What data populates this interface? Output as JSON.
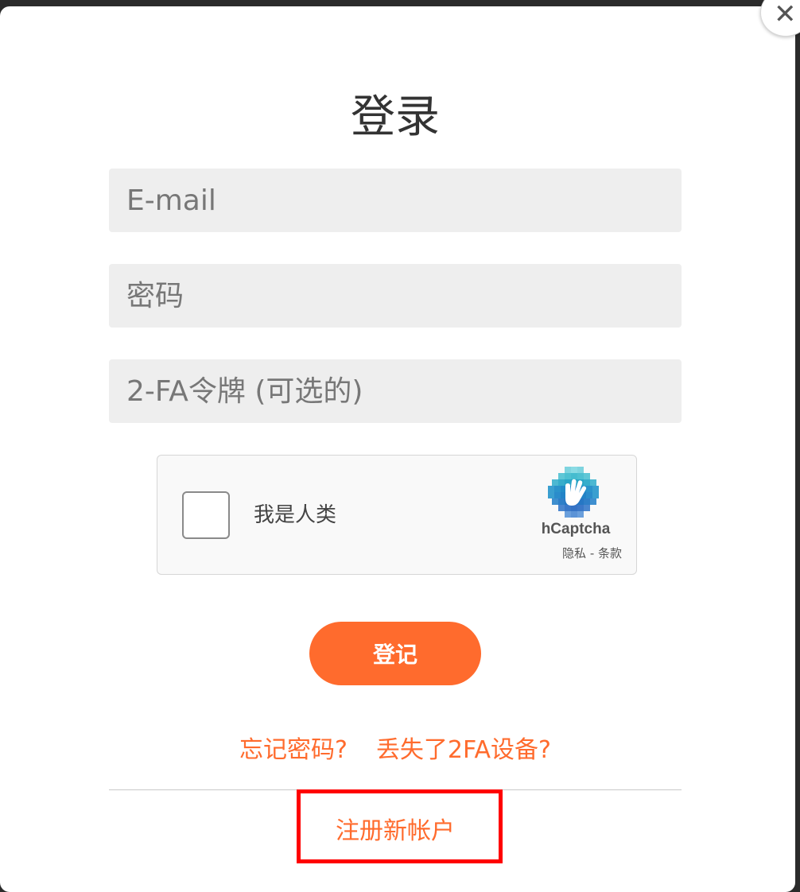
{
  "modal": {
    "title": "登录",
    "close_icon": "close-icon"
  },
  "form": {
    "email_placeholder": "E-mail",
    "password_placeholder": "密码",
    "twofa_placeholder": "2-FA令牌 (可选的)",
    "submit_label": "登记"
  },
  "captcha": {
    "label": "我是人类",
    "brand": "hCaptcha",
    "links": "隐私 - 条款"
  },
  "links": {
    "forgot_password": "忘记密码?",
    "lost_2fa": "丢失了2FA设备?",
    "register": "注册新帐户"
  },
  "colors": {
    "accent": "#ff6b2d",
    "highlight_box": "#ff0000",
    "field_bg": "#eeeeee"
  }
}
